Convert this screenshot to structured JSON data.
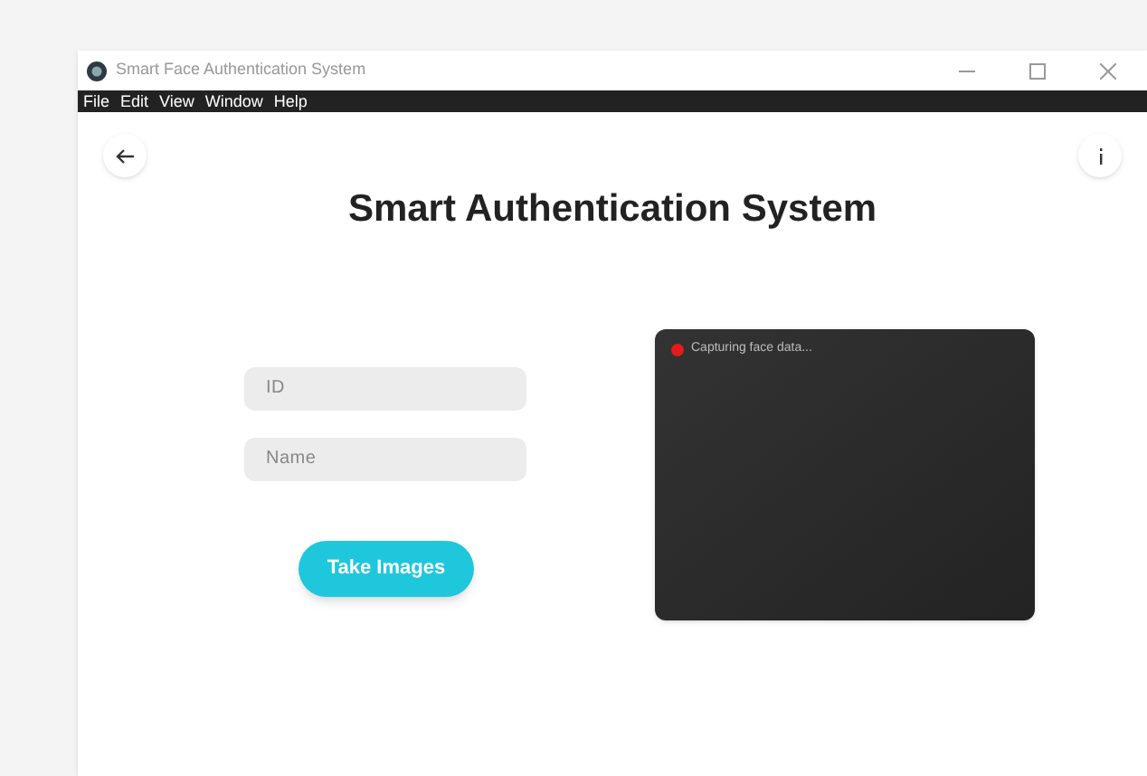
{
  "window": {
    "title": "Smart Face Authentication System"
  },
  "menu": [
    "File",
    "Edit",
    "View",
    "Window",
    "Help"
  ],
  "heading": "Smart Authentication System",
  "form": {
    "fields": [
      {
        "placeholder": "ID"
      },
      {
        "placeholder": "Name"
      }
    ],
    "button": "Take Images"
  },
  "camera": {
    "status": "Capturing face data...",
    "recording": true
  }
}
